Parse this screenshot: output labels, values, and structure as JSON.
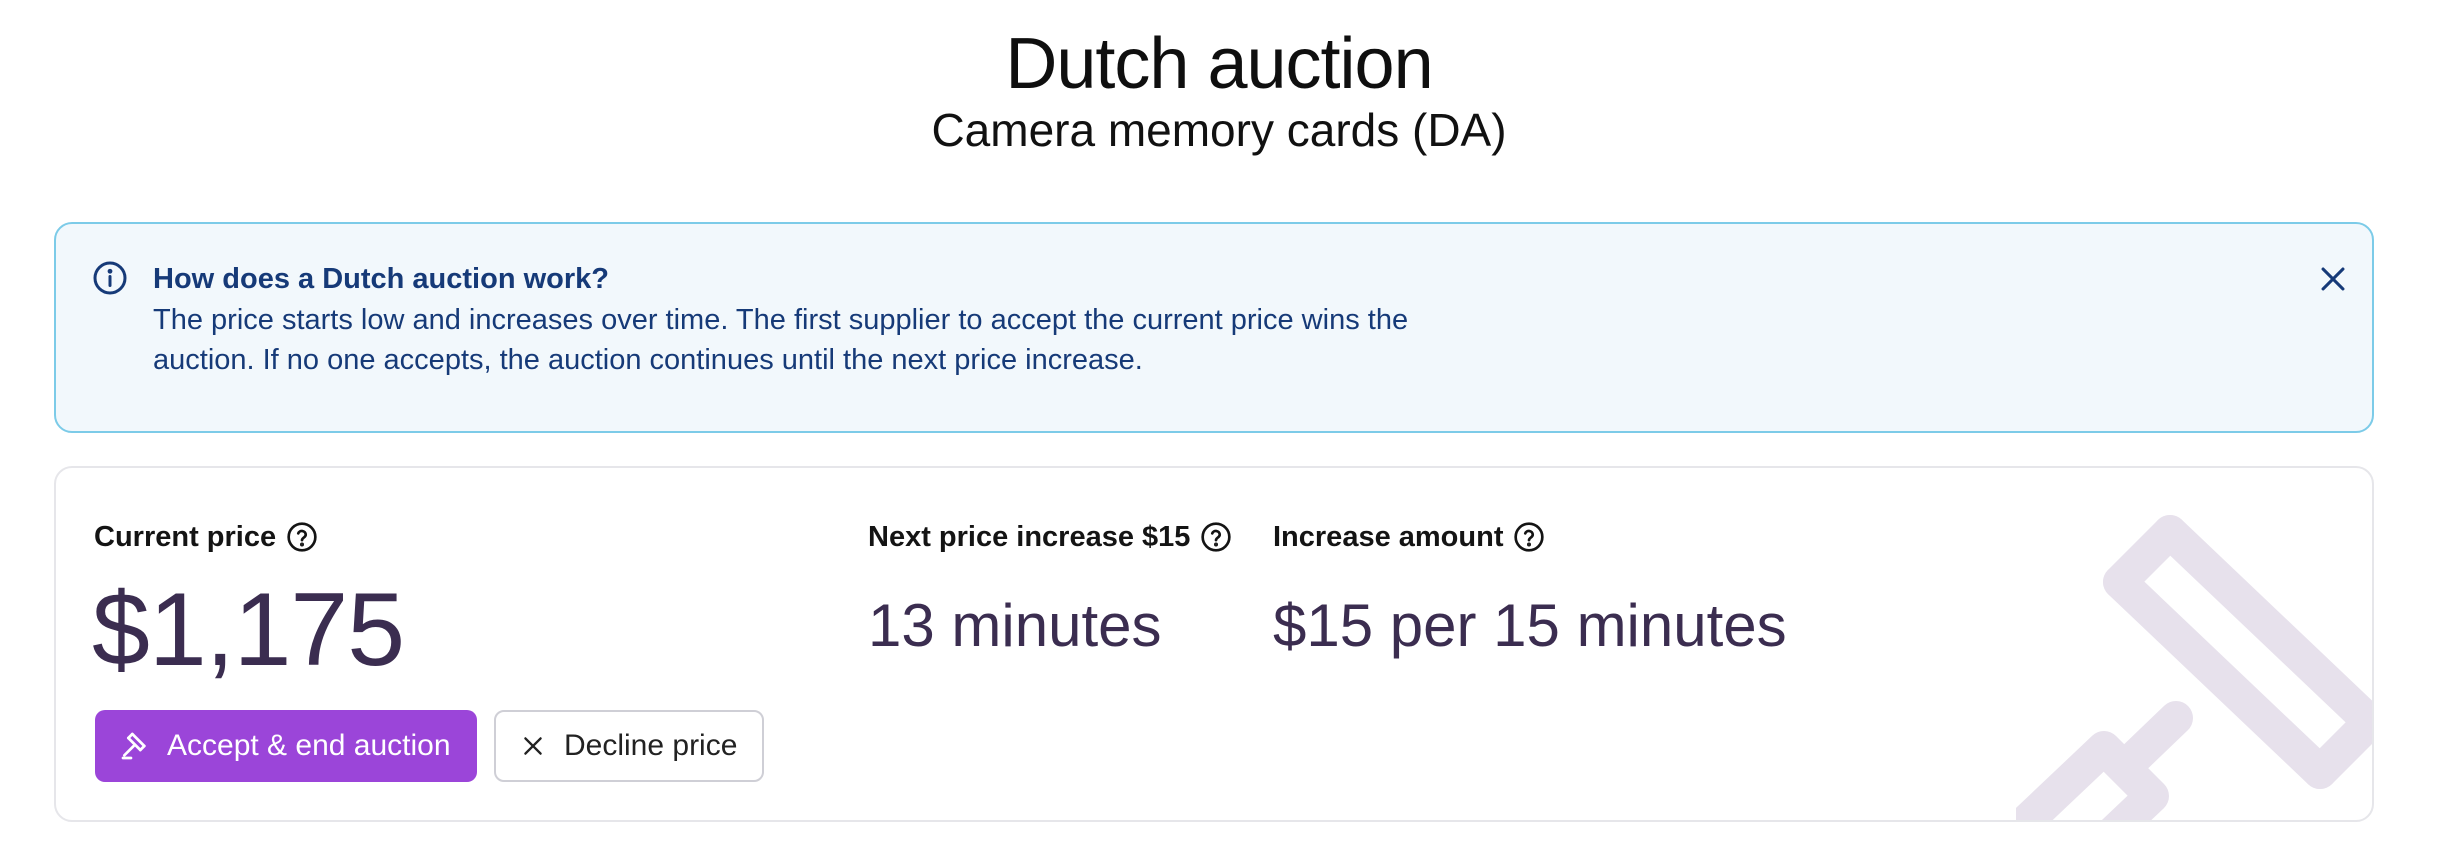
{
  "header": {
    "title": "Dutch auction",
    "subtitle": "Camera memory cards (DA)"
  },
  "info_banner": {
    "icon": "info-circle-icon",
    "title": "How does a Dutch auction work?",
    "body": "The price starts low and increases over time. The first supplier to accept the current price wins the auction. If no one accepts, the auction continues until the next price increase.",
    "close_icon": "close-icon"
  },
  "pricing": {
    "current_price_label": "Current price",
    "current_price_value": "$1,175",
    "next_increase_label": "Next price increase $15",
    "next_increase_value": "13 minutes",
    "increase_amount_label": "Increase amount",
    "increase_amount_value": "$15 per 15 minutes",
    "help_icon": "help-circle-icon",
    "watermark_icon": "gavel-icon"
  },
  "actions": {
    "accept_label": "Accept & end auction",
    "accept_icon": "gavel-icon",
    "decline_label": "Decline price",
    "decline_icon": "close-icon"
  },
  "colors": {
    "accent": "#9b45d9",
    "banner_background": "#f2f8fc",
    "banner_border": "#7ccbe8",
    "banner_text": "#163a78",
    "value_text": "#3b2d50"
  }
}
